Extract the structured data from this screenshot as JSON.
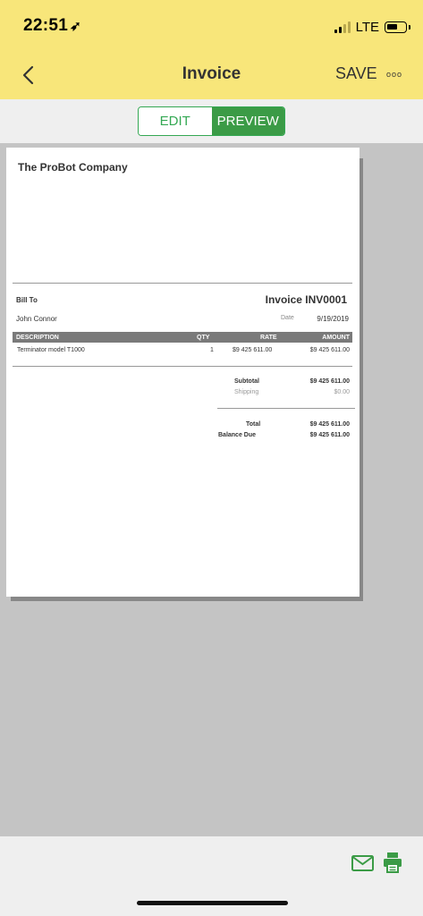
{
  "status_bar": {
    "time": "22:51",
    "network": "LTE"
  },
  "nav": {
    "title": "Invoice",
    "save_label": "SAVE",
    "more_label": "ooo"
  },
  "segments": {
    "edit": "EDIT",
    "preview": "PREVIEW",
    "selected": "PREVIEW"
  },
  "invoice": {
    "company": "The ProBot Company",
    "bill_to_label": "Bill To",
    "client": "John Connor",
    "invoice_number": "Invoice INV0001",
    "date_label": "Date",
    "date": "9/19/2019",
    "columns": {
      "description": "DESCRIPTION",
      "qty": "QTY",
      "rate": "RATE",
      "amount": "AMOUNT"
    },
    "items": [
      {
        "description": "Terminator model T1000",
        "qty": "1",
        "rate": "$9 425 611.00",
        "amount": "$9 425 611.00"
      }
    ],
    "subtotal_label": "Subtotal",
    "subtotal": "$9 425 611.00",
    "shipping_label": "Shipping",
    "shipping": "$0.00",
    "total_label": "Total",
    "total": "$9 425 611.00",
    "balance_label": "Balance Due",
    "balance": "$9 425 611.00"
  },
  "colors": {
    "header_bg": "#f8e67a",
    "accent_green": "#34a853",
    "preview_bg": "#c4c4c4"
  },
  "icons": {
    "back": "chevron-left-icon",
    "mail": "mail-icon",
    "print": "printer-icon"
  }
}
